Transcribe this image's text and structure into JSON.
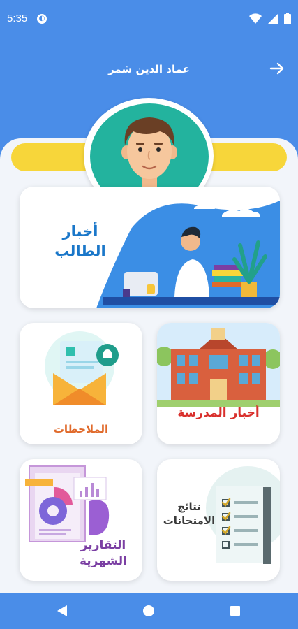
{
  "status_bar": {
    "time": "5:35",
    "notification_icon": "app-notification-icon",
    "icons": [
      "wifi-icon",
      "signal-icon",
      "battery-icon"
    ]
  },
  "header": {
    "title": "عماد الدين شمر",
    "back_icon": "arrow-right-icon"
  },
  "profile": {
    "avatar_icon": "student-avatar-icon"
  },
  "cards": {
    "student_news": {
      "label": "أخبار الطالب",
      "icon": "student-desk-illustration"
    },
    "school_news": {
      "label": "أخبار المدرسة",
      "icon": "school-building-illustration"
    },
    "notes": {
      "label": "الملاحظات",
      "icon": "envelope-bell-illustration"
    },
    "exam_results": {
      "label": "نتائج الامتحانات",
      "icon": "checklist-illustration"
    },
    "monthly_reports": {
      "label": "التقارير الشهرية",
      "icon": "report-charts-illustration"
    }
  },
  "nav_bar": {
    "back": "nav-back-icon",
    "home": "nav-home-icon",
    "recents": "nav-recents-icon"
  },
  "colors": {
    "primary": "#4a8de8",
    "accent_yellow": "#f7d63a",
    "avatar_bg": "#23b39e",
    "student_news_text": "#1a77c9",
    "school_news_text": "#d9302d",
    "notes_text": "#e06a2b",
    "reports_text": "#7b3fa3"
  }
}
